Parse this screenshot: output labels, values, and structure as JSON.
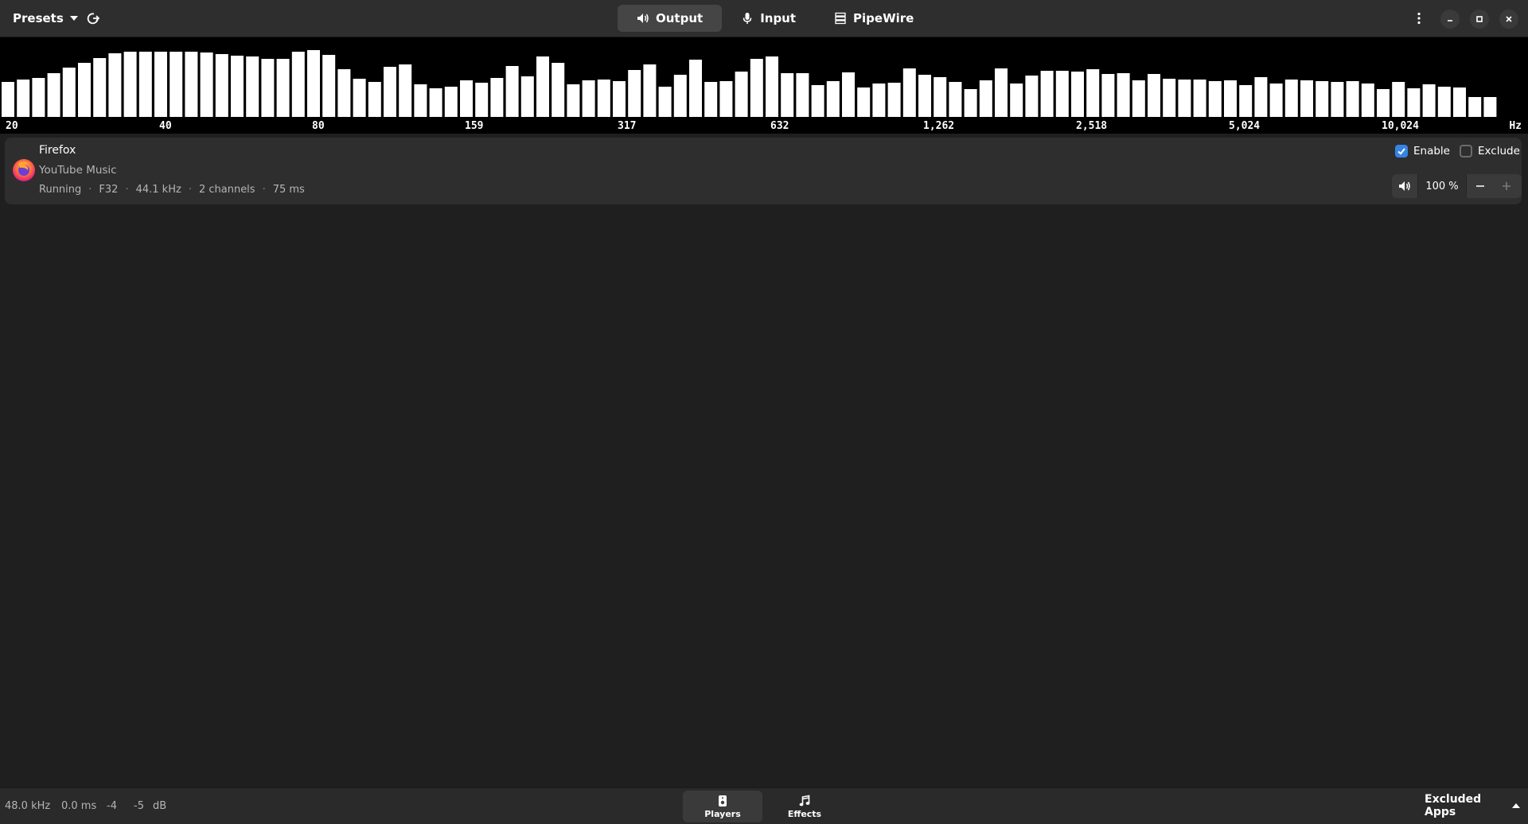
{
  "header": {
    "presets_label": "Presets",
    "tabs": [
      {
        "label": "Output",
        "icon": "speaker-icon",
        "active": true
      },
      {
        "label": "Input",
        "icon": "microphone-icon",
        "active": false
      },
      {
        "label": "PipeWire",
        "icon": "server-icon",
        "active": false
      }
    ]
  },
  "spectrum": {
    "unit": "Hz",
    "freq_labels": [
      "20",
      "40",
      "80",
      "159",
      "317",
      "632",
      "1,262",
      "2,518",
      "5,024",
      "10,024"
    ],
    "bar_levels": [
      0.44,
      0.47,
      0.49,
      0.55,
      0.62,
      0.68,
      0.74,
      0.8,
      0.82,
      0.82,
      0.82,
      0.82,
      0.82,
      0.81,
      0.79,
      0.77,
      0.76,
      0.73,
      0.73,
      0.82,
      0.84,
      0.78,
      0.6,
      0.48,
      0.44,
      0.63,
      0.66,
      0.41,
      0.36,
      0.38,
      0.46,
      0.43,
      0.49,
      0.64,
      0.51,
      0.76,
      0.68,
      0.41,
      0.46,
      0.47,
      0.45,
      0.59,
      0.66,
      0.38,
      0.53,
      0.72,
      0.44,
      0.45,
      0.57,
      0.73,
      0.76,
      0.55,
      0.55,
      0.4,
      0.45,
      0.56,
      0.37,
      0.42,
      0.43,
      0.61,
      0.53,
      0.5,
      0.44,
      0.35,
      0.46,
      0.61,
      0.42,
      0.52,
      0.58,
      0.58,
      0.57,
      0.6,
      0.54,
      0.55,
      0.46,
      0.54,
      0.48,
      0.47,
      0.47,
      0.45,
      0.46,
      0.4,
      0.5,
      0.42,
      0.47,
      0.46,
      0.45,
      0.44,
      0.45,
      0.42,
      0.35,
      0.44,
      0.36,
      0.41,
      0.38,
      0.37,
      0.25,
      0.25
    ],
    "bar_count": 97
  },
  "player": {
    "app_name": "Firefox",
    "media_name": "YouTube Music",
    "state": "Running",
    "format": "F32",
    "rate": "44.1 kHz",
    "channels": "2 channels",
    "latency": "75 ms",
    "separator": "·",
    "enable_label": "Enable",
    "enable_checked": true,
    "exclude_label": "Exclude",
    "exclude_checked": false,
    "volume": "100 %"
  },
  "statusbar": {
    "sample_rate": "48.0 kHz",
    "latency": "0.0 ms",
    "level_left": "-4",
    "level_right": "-5",
    "level_unit": "dB"
  },
  "bottom_tabs": [
    {
      "label": "Players",
      "icon": "speaker-device-icon",
      "active": true
    },
    {
      "label": "Effects",
      "icon": "music-note-icon",
      "active": false
    }
  ],
  "excluded_apps_label": "Excluded Apps",
  "colors": {
    "accent": "#3584e4",
    "header_bg": "#2e2e2e",
    "window_bg": "#1f1f1f",
    "spectrum_bg": "#000000",
    "spectrum_bar": "#ffffff"
  }
}
